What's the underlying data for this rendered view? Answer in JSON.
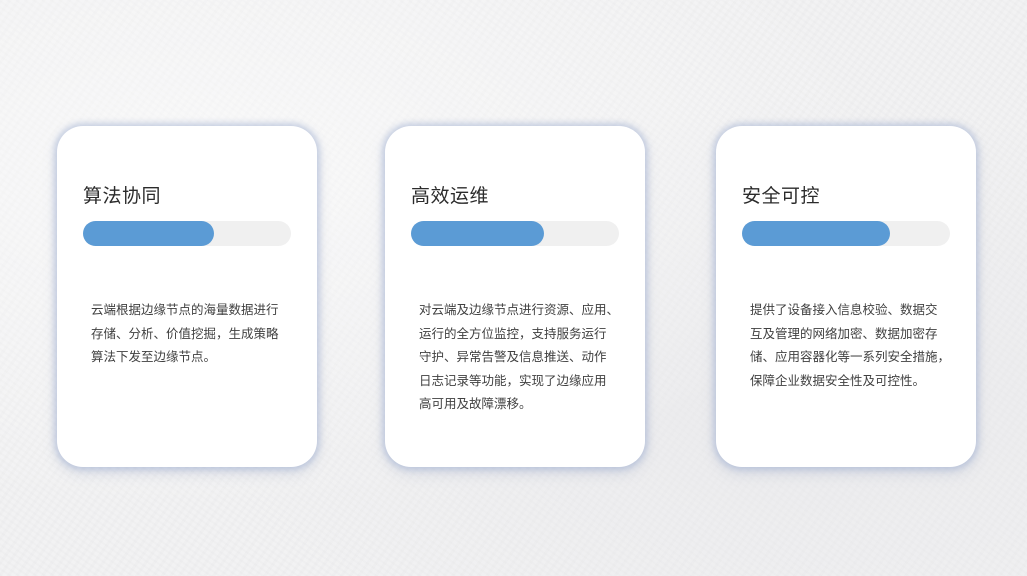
{
  "cards": [
    {
      "title": "算法协同",
      "progress": 0.63,
      "description": "云端根据边缘节点的海量数据进行\n存储、分析、价值挖掘，生成策略\n算法下发至边缘节点。"
    },
    {
      "title": "高效运维",
      "progress": 0.64,
      "description": "对云端及边缘节点进行资源、应用、\n运行的全方位监控，支持服务运行\n守护、异常告警及信息推送、动作\n日志记录等功能，实现了边缘应用\n高可用及故障漂移。"
    },
    {
      "title": "安全可控",
      "progress": 0.71,
      "description": "提供了设备接入信息校验、数据交\n互及管理的网络加密、数据加密存\n储、应用容器化等一系列安全措施，\n保障企业数据安全性及可控性。"
    }
  ],
  "colors": {
    "accent": "#5b9bd5",
    "track": "#f0f0f0",
    "card_shadow": "#a8b6d6",
    "background": "#f2f2f3"
  }
}
